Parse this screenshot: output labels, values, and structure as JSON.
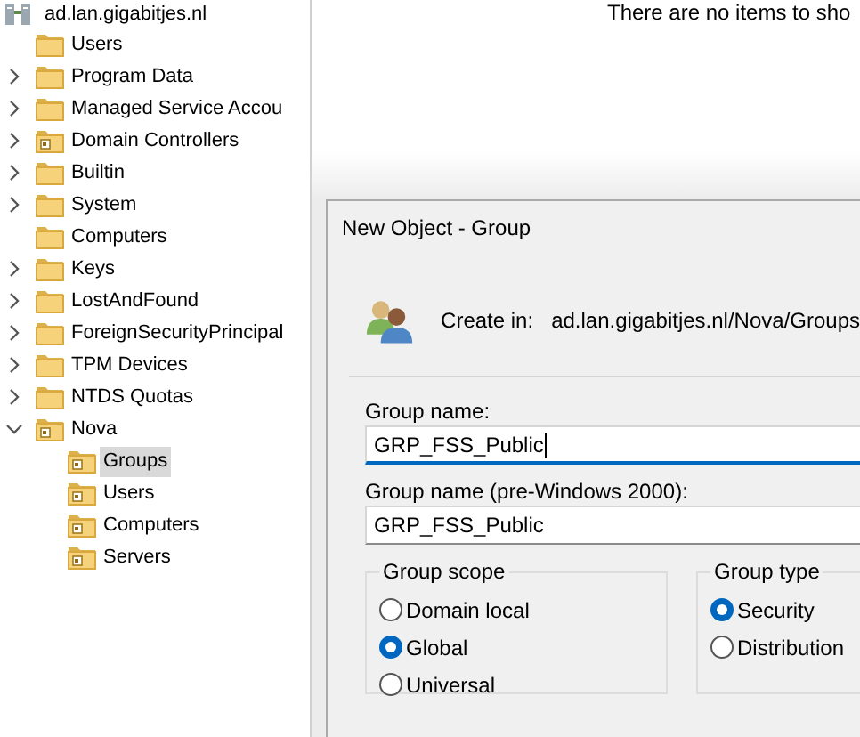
{
  "tree": {
    "root": {
      "label": "ad.lan.gigabitjes.nl"
    },
    "items": [
      {
        "label": "Users",
        "kind": "folder",
        "selected": false
      },
      {
        "label": "Program Data",
        "kind": "folder",
        "expanded": false,
        "selected": false
      },
      {
        "label": "Managed Service Accou",
        "kind": "folder",
        "expanded": false,
        "selected": false
      },
      {
        "label": "Domain Controllers",
        "kind": "ou",
        "expanded": false,
        "selected": false
      },
      {
        "label": "Builtin",
        "kind": "folder",
        "expanded": false,
        "selected": false
      },
      {
        "label": "System",
        "kind": "folder",
        "expanded": false,
        "selected": false
      },
      {
        "label": "Computers",
        "kind": "folder",
        "selected": false
      },
      {
        "label": "Keys",
        "kind": "folder",
        "expanded": false,
        "selected": false
      },
      {
        "label": "LostAndFound",
        "kind": "folder",
        "expanded": false,
        "selected": false
      },
      {
        "label": "ForeignSecurityPrincipal",
        "kind": "folder",
        "expanded": false,
        "selected": false
      },
      {
        "label": "TPM Devices",
        "kind": "folder",
        "expanded": false,
        "selected": false
      },
      {
        "label": "NTDS Quotas",
        "kind": "folder",
        "expanded": false,
        "selected": false
      },
      {
        "label": "Nova",
        "kind": "ou",
        "expanded": true,
        "selected": false,
        "children": [
          {
            "label": "Groups",
            "kind": "ou",
            "selected": true
          },
          {
            "label": "Users",
            "kind": "ou",
            "selected": false
          },
          {
            "label": "Computers",
            "kind": "ou",
            "selected": false
          },
          {
            "label": "Servers",
            "kind": "ou",
            "selected": false
          }
        ]
      }
    ]
  },
  "content_pane": {
    "empty_message": "There are no items to sho"
  },
  "dialog": {
    "title": "New Object - Group",
    "create_in_label": "Create in:",
    "create_in_path": "ad.lan.gigabitjes.nl/Nova/Groups",
    "fields": [
      {
        "label": "Group name:",
        "value": "GRP_FSS_Public",
        "focused": true
      },
      {
        "label": "Group name (pre-Windows 2000):",
        "value": "GRP_FSS_Public",
        "focused": false
      }
    ],
    "group_scope": {
      "title": "Group scope",
      "options": [
        {
          "label": "Domain local",
          "selected": false
        },
        {
          "label": "Global",
          "selected": true
        },
        {
          "label": "Universal",
          "selected": false
        }
      ]
    },
    "group_type": {
      "title": "Group type",
      "options": [
        {
          "label": "Security",
          "selected": true
        },
        {
          "label": "Distribution",
          "selected": false
        }
      ]
    }
  }
}
